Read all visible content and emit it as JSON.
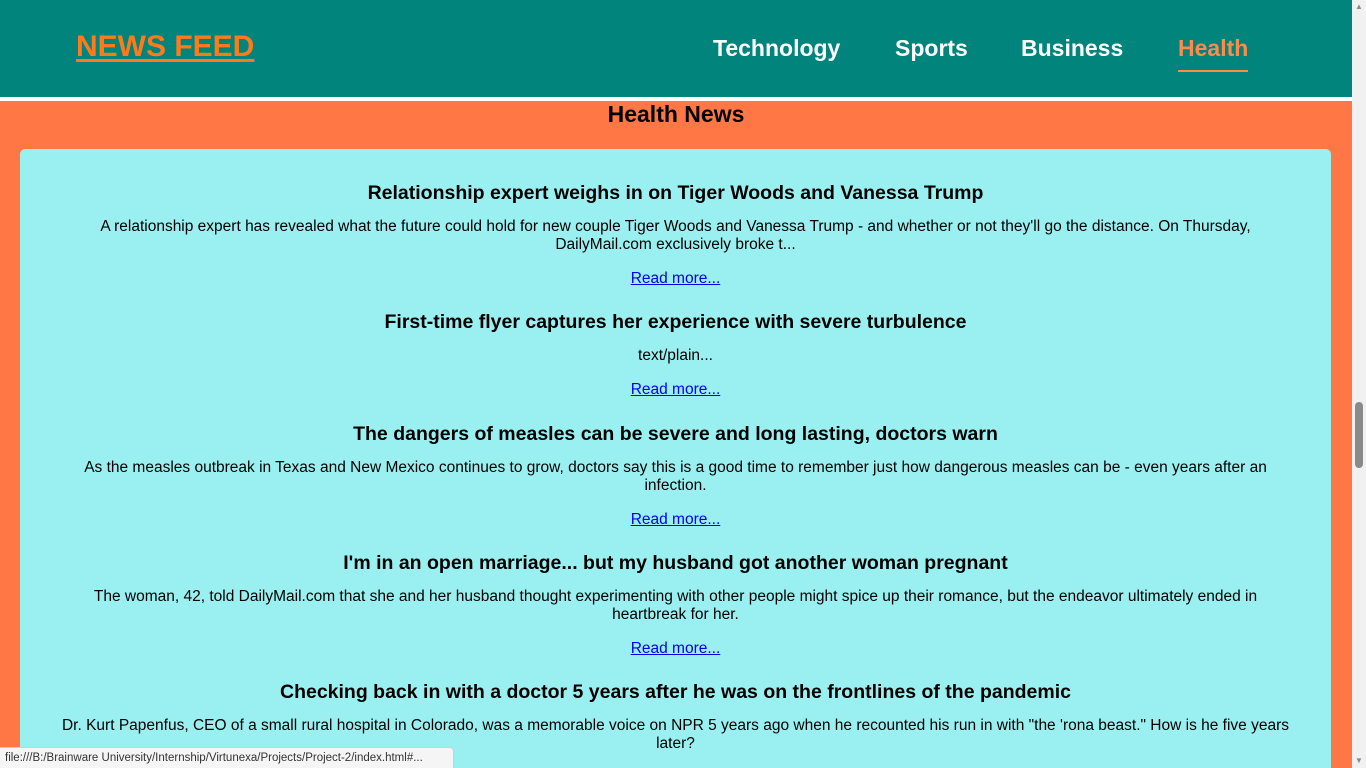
{
  "header": {
    "logo": "NEWS FEED",
    "nav": [
      {
        "label": "Technology",
        "active": false
      },
      {
        "label": "Sports",
        "active": false
      },
      {
        "label": "Business",
        "active": false
      },
      {
        "label": "Health",
        "active": true
      }
    ]
  },
  "section_title": "Health News",
  "articles": [
    {
      "title": "Relationship expert weighs in on Tiger Woods and Vanessa Trump",
      "summary": "A relationship expert has revealed what the future could hold for new couple Tiger Woods and Vanessa Trump - and whether or not they'll go the distance. On Thursday, DailyMail.com exclusively broke t...",
      "link": "Read more..."
    },
    {
      "title": "First-time flyer captures her experience with severe turbulence",
      "summary": "text/plain...",
      "link": "Read more..."
    },
    {
      "title": "The dangers of measles can be severe and long lasting, doctors warn",
      "summary": "As the measles outbreak in Texas and New Mexico continues to grow, doctors say this is a good time to remember just how dangerous measles can be - even years after an infection.",
      "link": "Read more..."
    },
    {
      "title": "I'm in an open marriage... but my husband got another woman pregnant",
      "summary": "The woman, 42, told DailyMail.com that she and her husband thought experimenting with other people might spice up their romance, but the endeavor ultimately ended in heartbreak for her.",
      "link": "Read more..."
    },
    {
      "title": "Checking back in with a doctor 5 years after he was on the frontlines of the pandemic",
      "summary": "Dr. Kurt Papenfus, CEO of a small rural hospital in Colorado, was a memorable voice on NPR 5 years ago when he recounted his run in with \"the 'rona beast.\" How is he five years later?",
      "link": ""
    }
  ],
  "status_bar": "file:///B:/Brainware University/Internship/Virtunexa/Projects/Project-2/index.html#...",
  "colors": {
    "header_bg": "#00847b",
    "page_bg": "#ff7744",
    "card_bg": "#9af0f0",
    "logo": "#ff7a1a",
    "active_nav": "#ff8a4a",
    "link": "#0000ee"
  }
}
